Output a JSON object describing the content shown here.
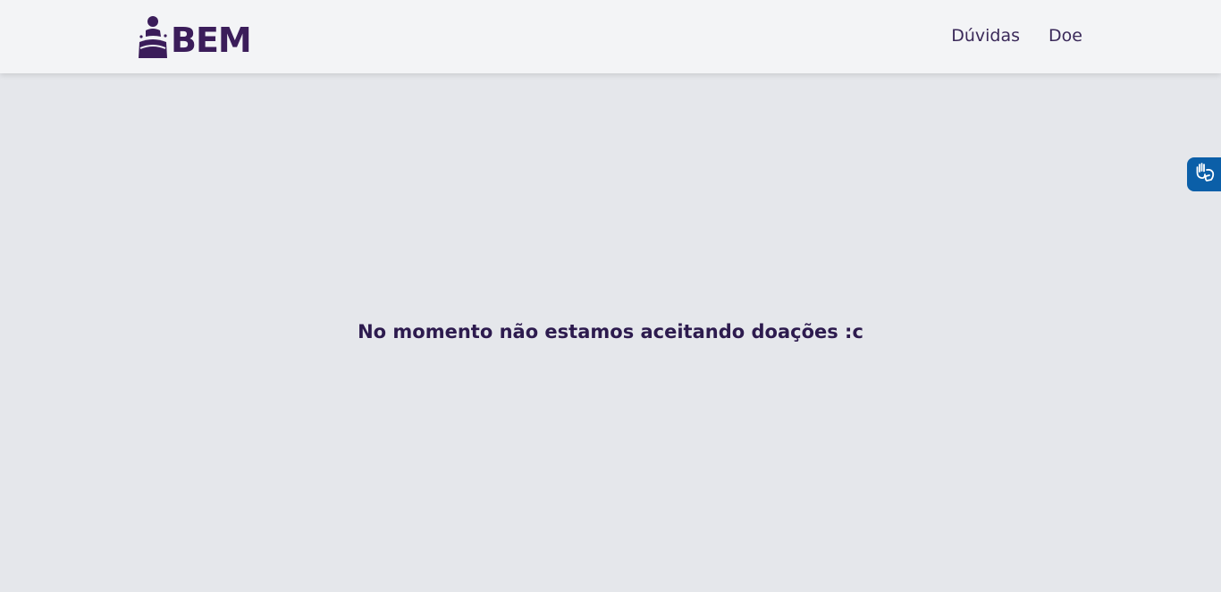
{
  "header": {
    "logo_text": "BEM",
    "nav": {
      "faq_label": "Dúvidas",
      "donate_label": "Doe"
    }
  },
  "main": {
    "message": "No momento não estamos aceitando doações :c"
  },
  "accessibility": {
    "widget_icon": "sign-language-hands-icon"
  },
  "colors": {
    "brand": "#3b1d5a",
    "header_bg": "#f3f4f6",
    "page_bg": "#e5e7eb",
    "widget_bg": "#0b5fa8"
  }
}
